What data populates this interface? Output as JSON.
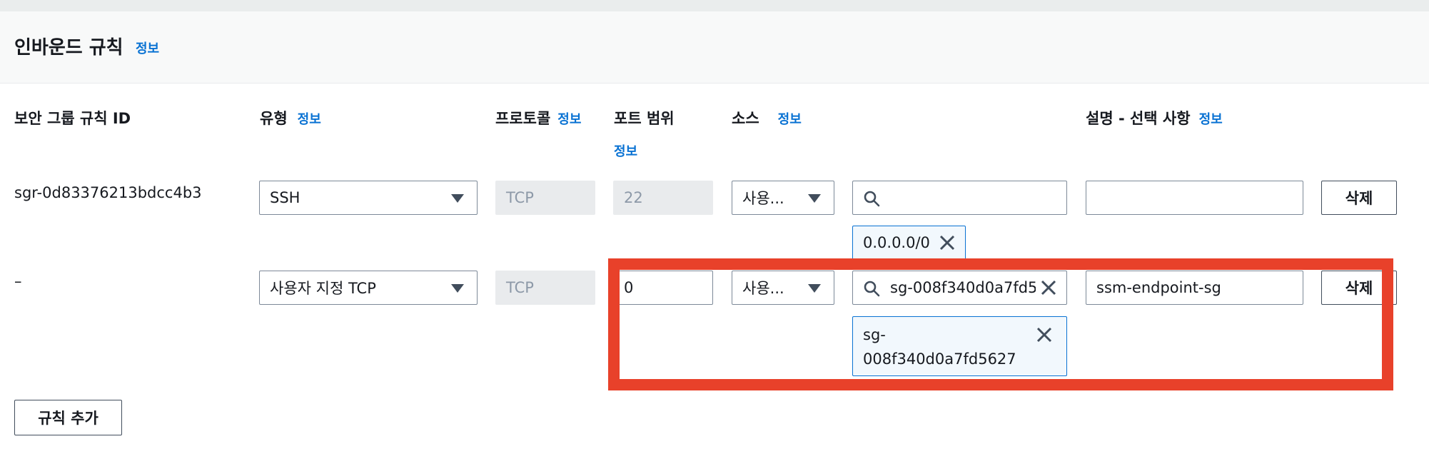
{
  "section": {
    "title": "인바운드 규칙",
    "info": "정보"
  },
  "columns": {
    "rule_id": "보안 그룹 규칙 ID",
    "type": "유형",
    "type_info": "정보",
    "protocol": "프로토콜",
    "protocol_info": "정보",
    "port_range": "포트 범위",
    "port_info": "정보",
    "source": "소스",
    "source_info": "정보",
    "description": "설명 - 선택 사항",
    "description_info": "정보"
  },
  "rows": [
    {
      "rule_id": "sgr-0d83376213bdcc4b3",
      "type": "SSH",
      "protocol": "TCP",
      "port": "22",
      "source_mode": "사용...",
      "source_search": "",
      "source_token": "0.0.0.0/0",
      "description": "",
      "delete": "삭제"
    },
    {
      "rule_id": "–",
      "type": "사용자 지정 TCP",
      "protocol": "TCP",
      "port": "0",
      "source_mode": "사용...",
      "source_search": "sg-008f340d0a7fd5627",
      "source_token_line1": "sg-",
      "source_token_line2": "008f340d0a7fd5627",
      "description": "ssm-endpoint-sg",
      "delete": "삭제"
    }
  ],
  "add_rule": "규칙 추가",
  "highlight_color": "#e8412a",
  "accent_color": "#0972d3"
}
